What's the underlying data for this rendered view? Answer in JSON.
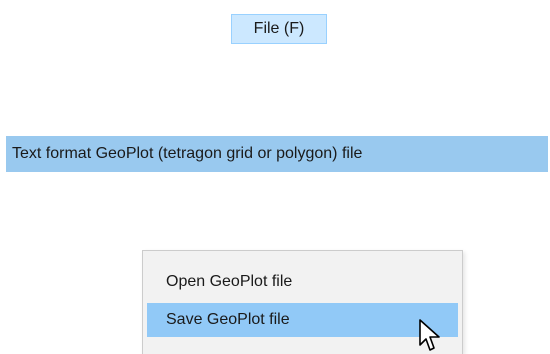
{
  "menubar": {
    "file_label": "File (F)"
  },
  "submenu": {
    "item_label": "Text format GeoPlot (tetragon grid or polygon) file"
  },
  "context_menu": {
    "items": [
      {
        "label": "Open GeoPlot file",
        "highlighted": false
      },
      {
        "label": "Save GeoPlot file",
        "highlighted": true
      }
    ]
  },
  "colors": {
    "file_bg": "#cce8ff",
    "file_border": "#99d1ff",
    "submenu_highlight": "#99c9ef",
    "popup_bg": "#f2f2f2",
    "popup_highlight": "#91c9f7"
  },
  "icons": {
    "pointer": "mouse-pointer-icon"
  }
}
